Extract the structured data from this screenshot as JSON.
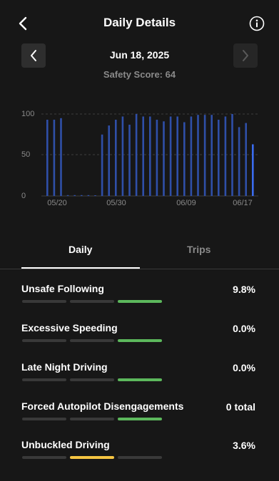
{
  "header": {
    "title": "Daily Details",
    "back_icon": "chevron-left-icon",
    "info_icon": "info-circle-icon"
  },
  "date_nav": {
    "date": "Jun 18, 2025",
    "safety_score": "Safety Score: 64",
    "prev_icon": "chevron-left-icon",
    "next_icon": "chevron-right-icon"
  },
  "chart_data": {
    "type": "bar",
    "x_tick_labels": [
      "05/20",
      "05/30",
      "06/09",
      "06/17"
    ],
    "y_tick_labels": [
      "100",
      "50",
      "0"
    ],
    "ylim": [
      0,
      100
    ],
    "grid": true,
    "values": [
      93,
      93,
      95,
      1,
      1,
      1,
      1,
      0,
      75,
      86,
      93,
      97,
      87,
      100,
      97,
      97,
      93,
      91,
      97,
      97,
      90,
      97,
      99,
      99,
      99,
      93,
      97,
      100,
      84,
      89,
      63
    ],
    "color": "#2f4fa8",
    "highlight_color": "#3a6cf0",
    "highlight_index": 30
  },
  "tabs": {
    "daily": "Daily",
    "trips": "Trips"
  },
  "metrics": [
    {
      "label": "Unsafe Following",
      "value": "9.8%",
      "level": 3,
      "color": "#5cb85c"
    },
    {
      "label": "Excessive Speeding",
      "value": "0.0%",
      "level": 3,
      "color": "#5cb85c"
    },
    {
      "label": "Late Night Driving",
      "value": "0.0%",
      "level": 3,
      "color": "#5cb85c"
    },
    {
      "label": "Forced Autopilot Disengagements",
      "value": "0 total",
      "level": 3,
      "color": "#5cb85c"
    },
    {
      "label": "Unbuckled Driving",
      "value": "3.6%",
      "level": 2,
      "color": "#f5c542"
    }
  ]
}
